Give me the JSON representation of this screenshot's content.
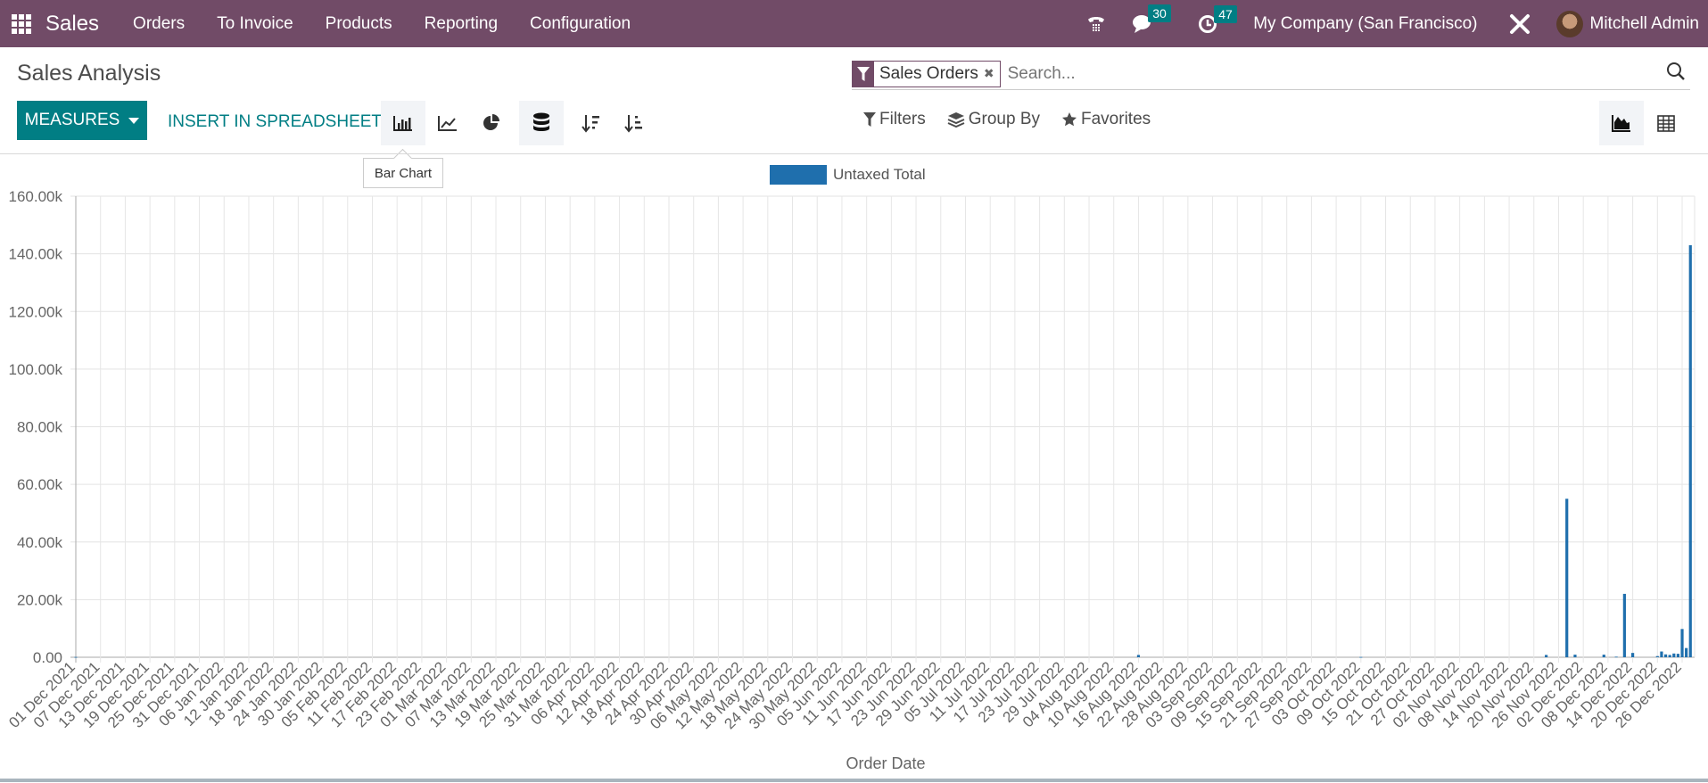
{
  "navbar": {
    "brand": "Sales",
    "menu": [
      "Orders",
      "To Invoice",
      "Products",
      "Reporting",
      "Configuration"
    ],
    "messages_count": "30",
    "activities_count": "47",
    "company": "My Company (San Francisco)",
    "user": "Mitchell Admin"
  },
  "page": {
    "title": "Sales Analysis",
    "measures_label": "MEASURES",
    "insert_label": "INSERT IN SPREADSHEET",
    "tooltip": "Bar Chart"
  },
  "search": {
    "facet_label": "Sales Orders",
    "placeholder": "Search...",
    "filters_label": "Filters",
    "groupby_label": "Group By",
    "favorites_label": "Favorites"
  },
  "colors": {
    "brand": "#714b67",
    "accent": "#017e84",
    "bar": "#1f6fad"
  },
  "chart_data": {
    "type": "bar",
    "title": "",
    "xlabel": "Order Date",
    "ylabel": "",
    "legend": [
      "Untaxed Total"
    ],
    "legend_position": "top-center",
    "grid": true,
    "ylim": [
      0,
      160000
    ],
    "yticks": [
      "0.00",
      "20.00k",
      "40.00k",
      "60.00k",
      "80.00k",
      "100.00k",
      "120.00k",
      "140.00k",
      "160.00k"
    ],
    "x_start": "2021-12-01",
    "x_end": "2022-12-31",
    "xtick_labels": [
      "01 Dec 2021",
      "07 Dec 2021",
      "13 Dec 2021",
      "19 Dec 2021",
      "25 Dec 2021",
      "31 Dec 2021",
      "06 Jan 2022",
      "12 Jan 2022",
      "18 Jan 2022",
      "24 Jan 2022",
      "30 Jan 2022",
      "05 Feb 2022",
      "11 Feb 2022",
      "17 Feb 2022",
      "23 Feb 2022",
      "01 Mar 2022",
      "07 Mar 2022",
      "13 Mar 2022",
      "19 Mar 2022",
      "25 Mar 2022",
      "31 Mar 2022",
      "06 Apr 2022",
      "12 Apr 2022",
      "18 Apr 2022",
      "24 Apr 2022",
      "30 Apr 2022",
      "06 May 2022",
      "12 May 2022",
      "18 May 2022",
      "24 May 2022",
      "30 May 2022",
      "05 Jun 2022",
      "11 Jun 2022",
      "17 Jun 2022",
      "23 Jun 2022",
      "29 Jun 2022",
      "05 Jul 2022",
      "11 Jul 2022",
      "17 Jul 2022",
      "23 Jul 2022",
      "29 Jul 2022",
      "04 Aug 2022",
      "10 Aug 2022",
      "16 Aug 2022",
      "22 Aug 2022",
      "28 Aug 2022",
      "03 Sep 2022",
      "09 Sep 2022",
      "15 Sep 2022",
      "21 Sep 2022",
      "27 Sep 2022",
      "03 Oct 2022",
      "09 Oct 2022",
      "15 Oct 2022",
      "21 Oct 2022",
      "27 Oct 2022",
      "02 Nov 2022",
      "08 Nov 2022",
      "14 Nov 2022",
      "20 Nov 2022",
      "26 Nov 2022",
      "02 Dec 2022",
      "08 Dec 2022",
      "14 Dec 2022",
      "20 Dec 2022",
      "26 Dec 2022"
    ],
    "series": [
      {
        "name": "Untaxed Total",
        "points": [
          {
            "date": "2021-12-01",
            "value": 100
          },
          {
            "date": "2022-08-16",
            "value": 800
          },
          {
            "date": "2022-10-09",
            "value": 100
          },
          {
            "date": "2022-11-23",
            "value": 800
          },
          {
            "date": "2022-11-28",
            "value": 55000
          },
          {
            "date": "2022-11-30",
            "value": 900
          },
          {
            "date": "2022-12-07",
            "value": 900
          },
          {
            "date": "2022-12-10",
            "value": 200
          },
          {
            "date": "2022-12-12",
            "value": 22000
          },
          {
            "date": "2022-12-14",
            "value": 1500
          },
          {
            "date": "2022-12-20",
            "value": 400
          },
          {
            "date": "2022-12-21",
            "value": 2000
          },
          {
            "date": "2022-12-22",
            "value": 1000
          },
          {
            "date": "2022-12-23",
            "value": 800
          },
          {
            "date": "2022-12-24",
            "value": 1300
          },
          {
            "date": "2022-12-25",
            "value": 1200
          },
          {
            "date": "2022-12-26",
            "value": 9800
          },
          {
            "date": "2022-12-27",
            "value": 3200
          },
          {
            "date": "2022-12-28",
            "value": 143000
          }
        ]
      }
    ]
  }
}
